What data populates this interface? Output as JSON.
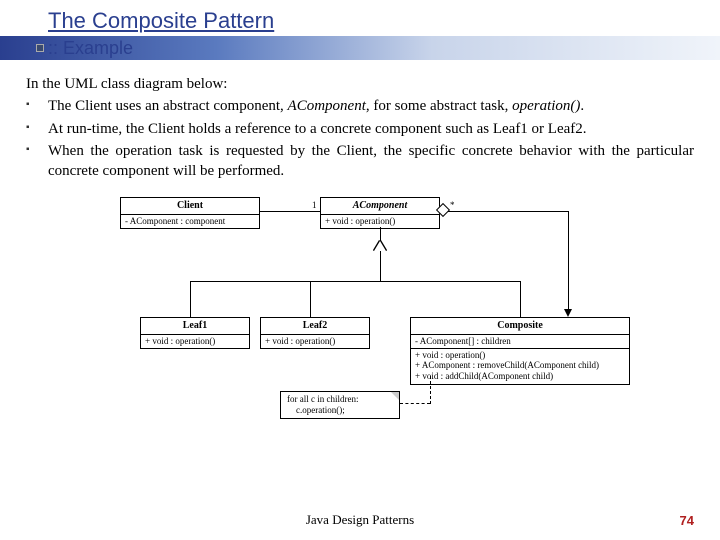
{
  "header": {
    "title": "The Composite Pattern",
    "subtitle": ":: Example"
  },
  "intro": "In the UML class diagram below:",
  "bullets": [
    {
      "pre": "The Client uses an abstract component, ",
      "em1": "AComponent",
      "mid": ", for some abstract task, ",
      "em2": "operation()",
      "post": "."
    },
    {
      "text": "At run-time, the Client holds a reference to a concrete component such as Leaf1 or Leaf2."
    },
    {
      "text": "When the operation task is requested by the Client, the specific concrete behavior with the particular concrete component will be performed."
    }
  ],
  "uml": {
    "client": {
      "name": "Client",
      "body": "- AComponent : component"
    },
    "acomponent": {
      "name": "AComponent",
      "body": "+ void : operation()"
    },
    "leaf1": {
      "name": "Leaf1",
      "body": "+ void : operation()"
    },
    "leaf2": {
      "name": "Leaf2",
      "body": "+ void : operation()"
    },
    "composite": {
      "name": "Composite",
      "body1": "- AComponent[] : children",
      "body2": "+ void : operation()",
      "body3": "+ AComponent : removeChild(AComponent child)",
      "body4": "+ void : addChild(AComponent child)"
    },
    "note": {
      "line1": "for all c in children:",
      "line2": "    c.operation();"
    },
    "mult": {
      "one": "1",
      "star": "*"
    }
  },
  "footer": {
    "center": "Java Design Patterns",
    "page": "74"
  }
}
